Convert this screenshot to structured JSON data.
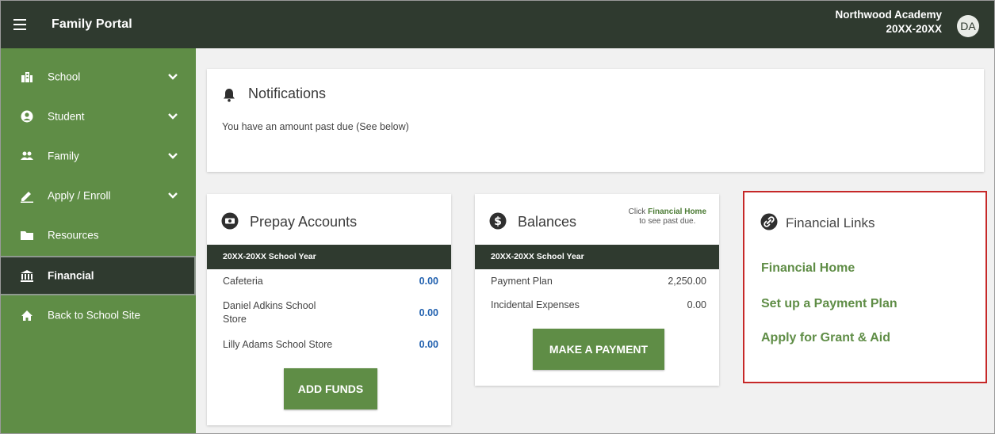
{
  "header": {
    "title": "Family Portal",
    "school_name": "Northwood Academy",
    "school_year": "20XX-20XX",
    "user_initials": "DA"
  },
  "sidebar": {
    "items": [
      {
        "label": "School",
        "icon": "building-icon",
        "has_chevron": true
      },
      {
        "label": "Student",
        "icon": "user-circle-icon",
        "has_chevron": true
      },
      {
        "label": "Family",
        "icon": "people-icon",
        "has_chevron": true
      },
      {
        "label": "Apply / Enroll",
        "icon": "pencil-icon",
        "has_chevron": true
      },
      {
        "label": "Resources",
        "icon": "folder-icon",
        "has_chevron": false
      },
      {
        "label": "Financial",
        "icon": "bank-icon",
        "has_chevron": false,
        "active": true
      },
      {
        "label": "Back to School Site",
        "icon": "home-icon",
        "has_chevron": false
      }
    ]
  },
  "notifications": {
    "title": "Notifications",
    "message": "You have an amount past due (See below)"
  },
  "prepay": {
    "title": "Prepay Accounts",
    "year_label": "20XX-20XX School Year",
    "rows": [
      {
        "label": "Cafeteria",
        "amount": "0.00"
      },
      {
        "label": "Daniel Adkins School Store",
        "amount": "0.00"
      },
      {
        "label": "Lilly Adams School Store",
        "amount": "0.00"
      }
    ],
    "button_label": "ADD FUNDS"
  },
  "balances": {
    "title": "Balances",
    "hint_prefix": "Click",
    "hint_link": "Financial Home",
    "hint_suffix": "to see past due.",
    "year_label": "20XX-20XX School Year",
    "rows": [
      {
        "label": "Payment Plan",
        "amount": "2,250.00"
      },
      {
        "label": "Incidental Expenses",
        "amount": "0.00"
      }
    ],
    "button_label": "MAKE A PAYMENT"
  },
  "financial_links": {
    "title": "Financial Links",
    "links": [
      "Financial Home",
      "Set up a Payment Plan",
      "Apply for Grant & Aid"
    ]
  },
  "colors": {
    "header": "#2f3a2f",
    "sidebar": "#5f8d46",
    "accent": "#5f8d46",
    "highlight_border": "#c62828",
    "amount_blue": "#1f5fae"
  }
}
